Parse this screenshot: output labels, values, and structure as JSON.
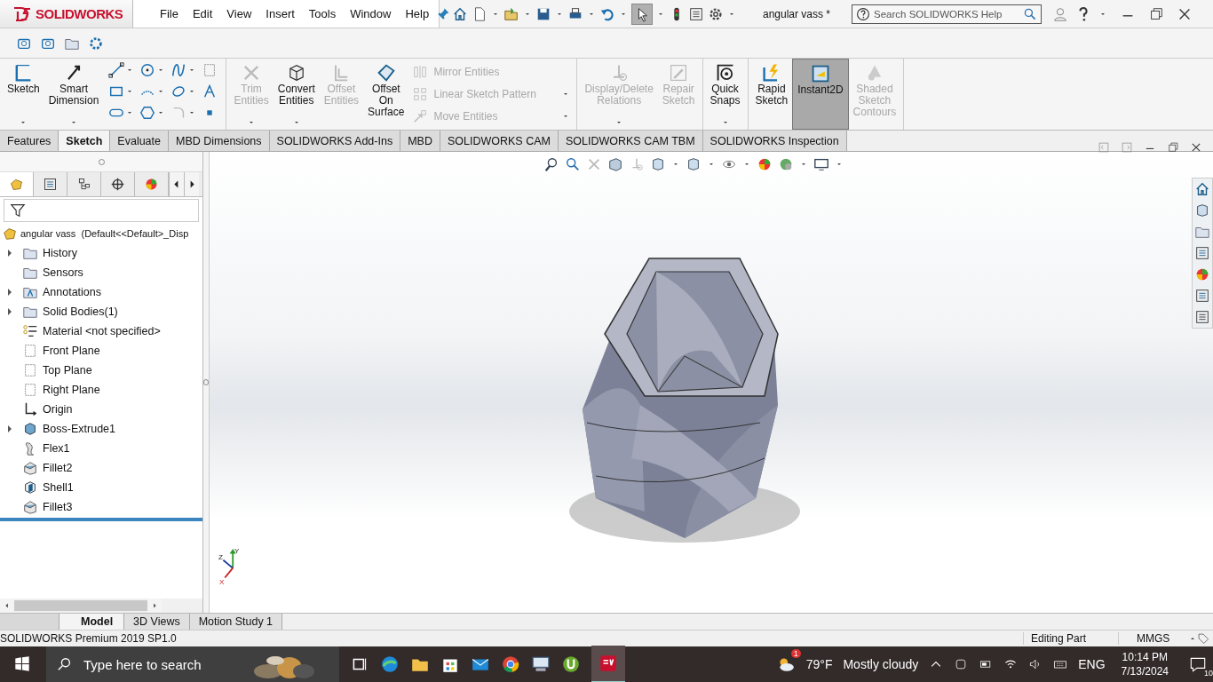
{
  "app": {
    "logo": "SOLIDWORKS",
    "menu": [
      "File",
      "Edit",
      "View",
      "Insert",
      "Tools",
      "Window",
      "Help"
    ],
    "document_title": "angular vass *",
    "search": {
      "placeholder": "Search SOLIDWORKS Help"
    }
  },
  "ribbon": [
    {
      "items": [
        {
          "kind": "large",
          "label": "Sketch",
          "disabled": false,
          "selected": false,
          "dropdown": true
        },
        {
          "kind": "large",
          "label": "Smart Dimension",
          "disabled": false,
          "selected": false,
          "dropdown": true
        },
        {
          "kind": "tools"
        }
      ]
    },
    {
      "items": [
        {
          "kind": "large",
          "label": "Trim Entities",
          "disabled": true,
          "selected": false,
          "dropdown": true
        },
        {
          "kind": "large",
          "label": "Convert Entities",
          "disabled": false,
          "selected": false,
          "dropdown": true
        },
        {
          "kind": "large",
          "label": "Offset Entities",
          "disabled": true,
          "selected": false,
          "dropdown": false
        },
        {
          "kind": "large",
          "label": "Offset On Surface",
          "disabled": false,
          "selected": false,
          "dropdown": false
        },
        {
          "kind": "list",
          "rows": [
            {
              "label": "Mirror Entities",
              "disabled": true,
              "dropdown": false
            },
            {
              "label": "Linear Sketch Pattern",
              "disabled": true,
              "dropdown": true
            },
            {
              "label": "Move Entities",
              "disabled": true,
              "dropdown": true
            }
          ]
        }
      ]
    },
    {
      "items": [
        {
          "kind": "large",
          "label": "Display/Delete Relations",
          "disabled": true,
          "selected": false,
          "dropdown": true
        },
        {
          "kind": "large",
          "label": "Repair Sketch",
          "disabled": true,
          "selected": false,
          "dropdown": false
        }
      ]
    },
    {
      "items": [
        {
          "kind": "large",
          "label": "Quick Snaps",
          "disabled": false,
          "selected": false,
          "dropdown": true
        }
      ]
    },
    {
      "items": [
        {
          "kind": "large",
          "label": "Rapid Sketch",
          "disabled": false,
          "selected": false,
          "dropdown": false
        },
        {
          "kind": "large",
          "label": "Instant2D",
          "disabled": false,
          "selected": true,
          "dropdown": false
        },
        {
          "kind": "large",
          "label": "Shaded Sketch Contours",
          "disabled": true,
          "selected": false,
          "dropdown": false
        }
      ]
    }
  ],
  "tabs": [
    {
      "label": "Features",
      "selected": false
    },
    {
      "label": "Sketch",
      "selected": true
    },
    {
      "label": "Evaluate",
      "selected": false
    },
    {
      "label": "MBD Dimensions",
      "selected": false
    },
    {
      "label": "SOLIDWORKS Add-Ins",
      "selected": false
    },
    {
      "label": "MBD",
      "selected": false
    },
    {
      "label": "SOLIDWORKS CAM",
      "selected": false
    },
    {
      "label": "SOLIDWORKS CAM TBM",
      "selected": false
    },
    {
      "label": "SOLIDWORKS Inspection",
      "selected": false
    }
  ],
  "tree": {
    "root": "angular vass  (Default<<Default>_Disp",
    "items": [
      {
        "label": "History",
        "expanded": false
      },
      {
        "label": "Sensors"
      },
      {
        "label": "Annotations",
        "expanded": false
      },
      {
        "label": "Solid Bodies(1)",
        "expanded": false
      },
      {
        "label": "Material <not specified>"
      },
      {
        "label": "Front Plane"
      },
      {
        "label": "Top Plane"
      },
      {
        "label": "Right Plane"
      },
      {
        "label": "Origin"
      },
      {
        "label": "Boss-Extrude1",
        "expanded": false
      },
      {
        "label": "Flex1"
      },
      {
        "label": "Fillet2"
      },
      {
        "label": "Shell1"
      },
      {
        "label": "Fillet3"
      }
    ]
  },
  "viewport": {
    "triad": {
      "x": "X",
      "y": "Y",
      "z": "Z"
    }
  },
  "bottom_tabs": [
    {
      "label": "Model",
      "selected": true
    },
    {
      "label": "3D Views",
      "selected": false
    },
    {
      "label": "Motion Study 1",
      "selected": false
    }
  ],
  "status_bar": {
    "product": "SOLIDWORKS Premium 2019 SP1.0",
    "mode": "Editing Part",
    "units": "MMGS"
  },
  "taskbar": {
    "search": {
      "placeholder": "Type here to search"
    },
    "weather": {
      "temperature": "79°F",
      "condition": "Mostly cloudy",
      "badge": "1"
    },
    "language": "ENG",
    "time": "10:14 PM",
    "date": "7/13/2024",
    "notifications": "10"
  }
}
